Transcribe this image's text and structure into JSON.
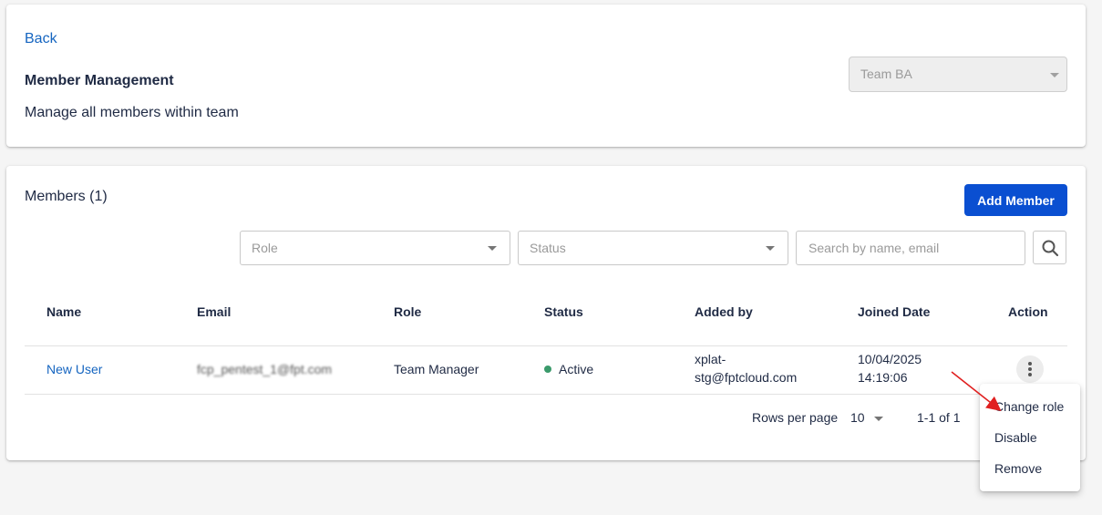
{
  "header": {
    "back_label": "Back",
    "title": "Member Management",
    "subtitle": "Manage all members within team",
    "team_select_value": "Team BA"
  },
  "members": {
    "title": "Members (1)",
    "add_button_label": "Add Member",
    "filters": {
      "role_placeholder": "Role",
      "status_placeholder": "Status",
      "search_placeholder": "Search by name, email"
    },
    "columns": [
      "Name",
      "Email",
      "Role",
      "Status",
      "Added by",
      "Joined Date",
      "Action"
    ],
    "rows": [
      {
        "name": "New User",
        "email": "fcp_pentest_1@fpt.com",
        "role": "Team Manager",
        "status": "Active",
        "added_by_line1": "xplat-",
        "added_by_line2": "stg@fptcloud.com",
        "joined_date": "10/04/2025",
        "joined_time": "14:19:06"
      }
    ],
    "pagination": {
      "rows_per_page_label": "Rows per page",
      "rows_per_page_value": "10",
      "range_text": "1-1 of 1"
    }
  },
  "action_menu": {
    "items": [
      "Change role",
      "Disable",
      "Remove"
    ]
  },
  "colors": {
    "primary": "#0a4fd1",
    "link": "#1565c0",
    "status_active": "#3a9a6b",
    "annotation_arrow": "#e02020"
  },
  "icons": {
    "search": "search-icon",
    "kebab": "more-vertical-icon",
    "dropdown": "chevron-down-icon"
  }
}
